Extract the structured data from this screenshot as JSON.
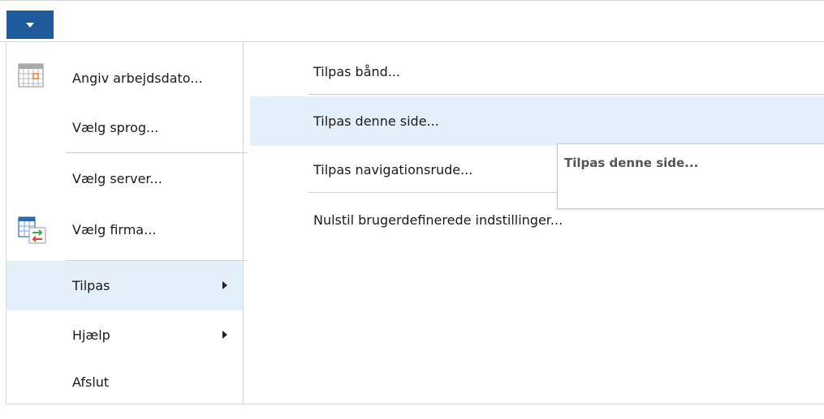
{
  "app_menu": {
    "button_icon": "caret-down-icon"
  },
  "left_menu": {
    "items": [
      {
        "label": "Angiv arbejdsdato...",
        "icon": "calendar-icon"
      },
      {
        "label": "Vælg sprog..."
      },
      {
        "label": "Vælg server..."
      },
      {
        "label": "Vælg firma...",
        "icon": "switch-company-icon"
      },
      {
        "label": "Tilpas",
        "has_submenu": true,
        "active": true
      },
      {
        "label": "Hjælp",
        "has_submenu": true
      },
      {
        "label": "Afslut"
      }
    ]
  },
  "sub_menu": {
    "items": [
      {
        "label": "Tilpas bånd..."
      },
      {
        "label": "Tilpas denne side...",
        "active": true
      },
      {
        "label": "Tilpas navigationsrude..."
      },
      {
        "label": "Nulstil brugerdefinerede indstillinger..."
      }
    ]
  },
  "tooltip": {
    "title": "Tilpas denne side..."
  },
  "colors": {
    "accent": "#1e5a9c",
    "hover_bg": "#e3eff9",
    "separator": "#cfcfcf",
    "calendar_orange": "#e8772e",
    "arrow_green": "#3aa655",
    "arrow_red": "#d9442b"
  }
}
